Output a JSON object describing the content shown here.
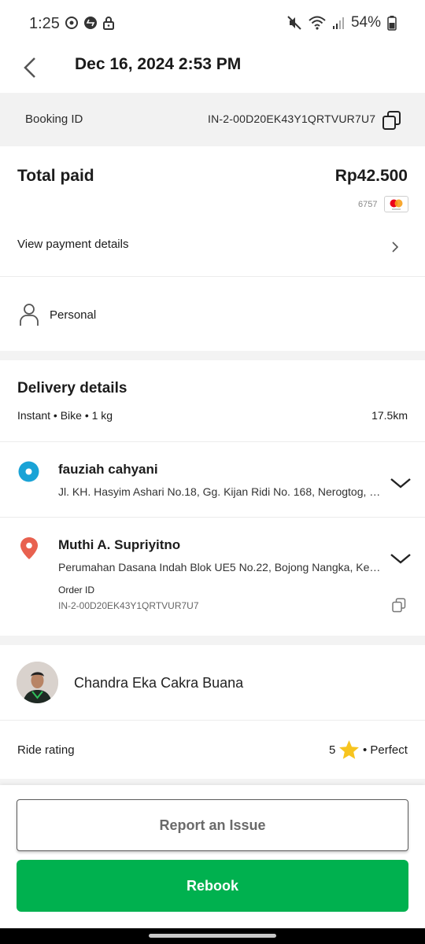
{
  "status_bar": {
    "time": "1:25",
    "battery": "54%",
    "left_icons": [
      "sync-icon",
      "shazam-icon",
      "lock-icon"
    ],
    "right_icons": [
      "mute-icon",
      "wifi-icon",
      "signal-icon",
      "battery-icon"
    ]
  },
  "header": {
    "title": "Dec 16, 2024 2:53 PM",
    "back_icon": "chevron-left-icon"
  },
  "booking": {
    "label": "Booking ID",
    "id": "IN-2-00D20EK43Y1QRTVUR7U7",
    "copy_icon": "copy-icon"
  },
  "payment": {
    "total_label": "Total paid",
    "total_value": "Rp42.500",
    "card_last4": "6757",
    "card_brand_icon": "mastercard-icon",
    "view_details_label": "View payment details"
  },
  "profile": {
    "label": "Personal",
    "icon": "person-icon"
  },
  "delivery": {
    "title": "Delivery details",
    "summary": "Instant • Bike • 1 kg",
    "distance": "17.5km",
    "pickup": {
      "name": "fauziah cahyani",
      "address": "Jl. KH. Hasyim Ashari No.18, Gg. Kijan Ridi No. 168, Nerogtog, Pinang, Tangerang",
      "icon": "pickup-dot-icon"
    },
    "dropoff": {
      "name": "Muthi A. Supriyitno",
      "address": "Perumahan Dasana Indah Blok UE5 No.22, Bojong Nangka, Kelapa Dua, Tangerang",
      "icon": "location-pin-icon",
      "order_label": "Order ID",
      "order_id": "IN-2-00D20EK43Y1QRTVUR7U7"
    }
  },
  "driver": {
    "name": "Chandra Eka Cakra Buana"
  },
  "rating": {
    "label": "Ride rating",
    "value": "5",
    "text": "• Perfect",
    "star_color": "#f7c41f"
  },
  "actions": {
    "report_label": "Report an Issue",
    "rebook_label": "Rebook"
  },
  "colors": {
    "brand_green": "#00b14f",
    "pickup_blue": "#1aa3d6",
    "dropoff_red": "#e8614f"
  }
}
